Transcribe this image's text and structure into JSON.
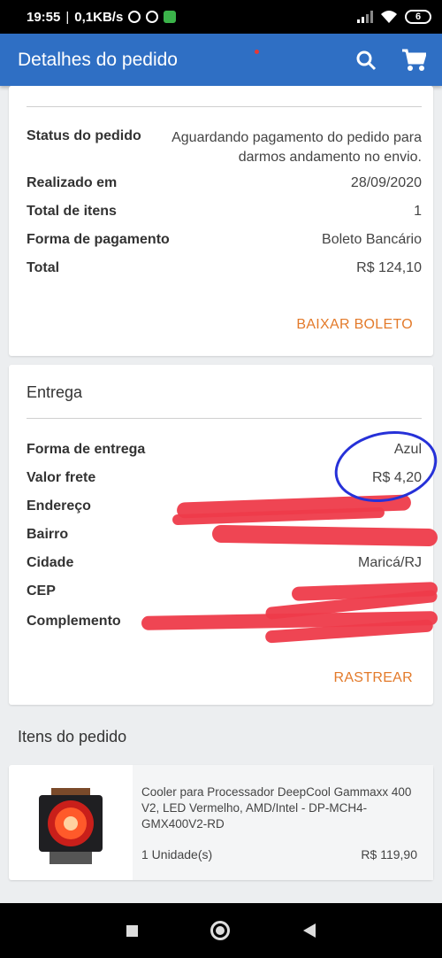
{
  "statusbar": {
    "time": "19:55",
    "net": "0,1KB/s",
    "battery": "6"
  },
  "appbar": {
    "title": "Detalhes do pedido",
    "icons": [
      "search-icon",
      "cart-icon"
    ]
  },
  "order": {
    "rows": [
      {
        "label": "Status do pedido",
        "value": "Aguardando pagamento do pedido para darmos andamento no envio."
      },
      {
        "label": "Realizado em",
        "value": "28/09/2020"
      },
      {
        "label": "Total de itens",
        "value": "1"
      },
      {
        "label": "Forma de pagamento",
        "value": "Boleto Bancário"
      },
      {
        "label": "Total",
        "value": "R$ 124,10"
      }
    ],
    "action": "BAIXAR BOLETO"
  },
  "delivery": {
    "title": "Entrega",
    "rows": [
      {
        "label": "Forma de entrega",
        "value": "Azul"
      },
      {
        "label": "Valor frete",
        "value": "R$ 4,20"
      },
      {
        "label": "Endereço",
        "value": ""
      },
      {
        "label": "Bairro",
        "value": ""
      },
      {
        "label": "Cidade",
        "value": "Maricá/RJ"
      },
      {
        "label": "CEP",
        "value": ""
      },
      {
        "label": "Complemento",
        "value": ""
      }
    ],
    "action": "RASTREAR"
  },
  "items": {
    "title": "Itens do pedido",
    "list": [
      {
        "name": "Cooler para Processador DeepCool Gammaxx 400 V2, LED Vermelho, AMD/Intel - DP-MCH4-GMX400V2-RD",
        "qty": "1 Unidade(s)",
        "price": "R$ 119,90"
      }
    ]
  },
  "colors": {
    "appbar": "#2f6fc4",
    "accent": "#e37a2a",
    "redaction": "#ee3b4a",
    "annotation": "#2631d8"
  }
}
